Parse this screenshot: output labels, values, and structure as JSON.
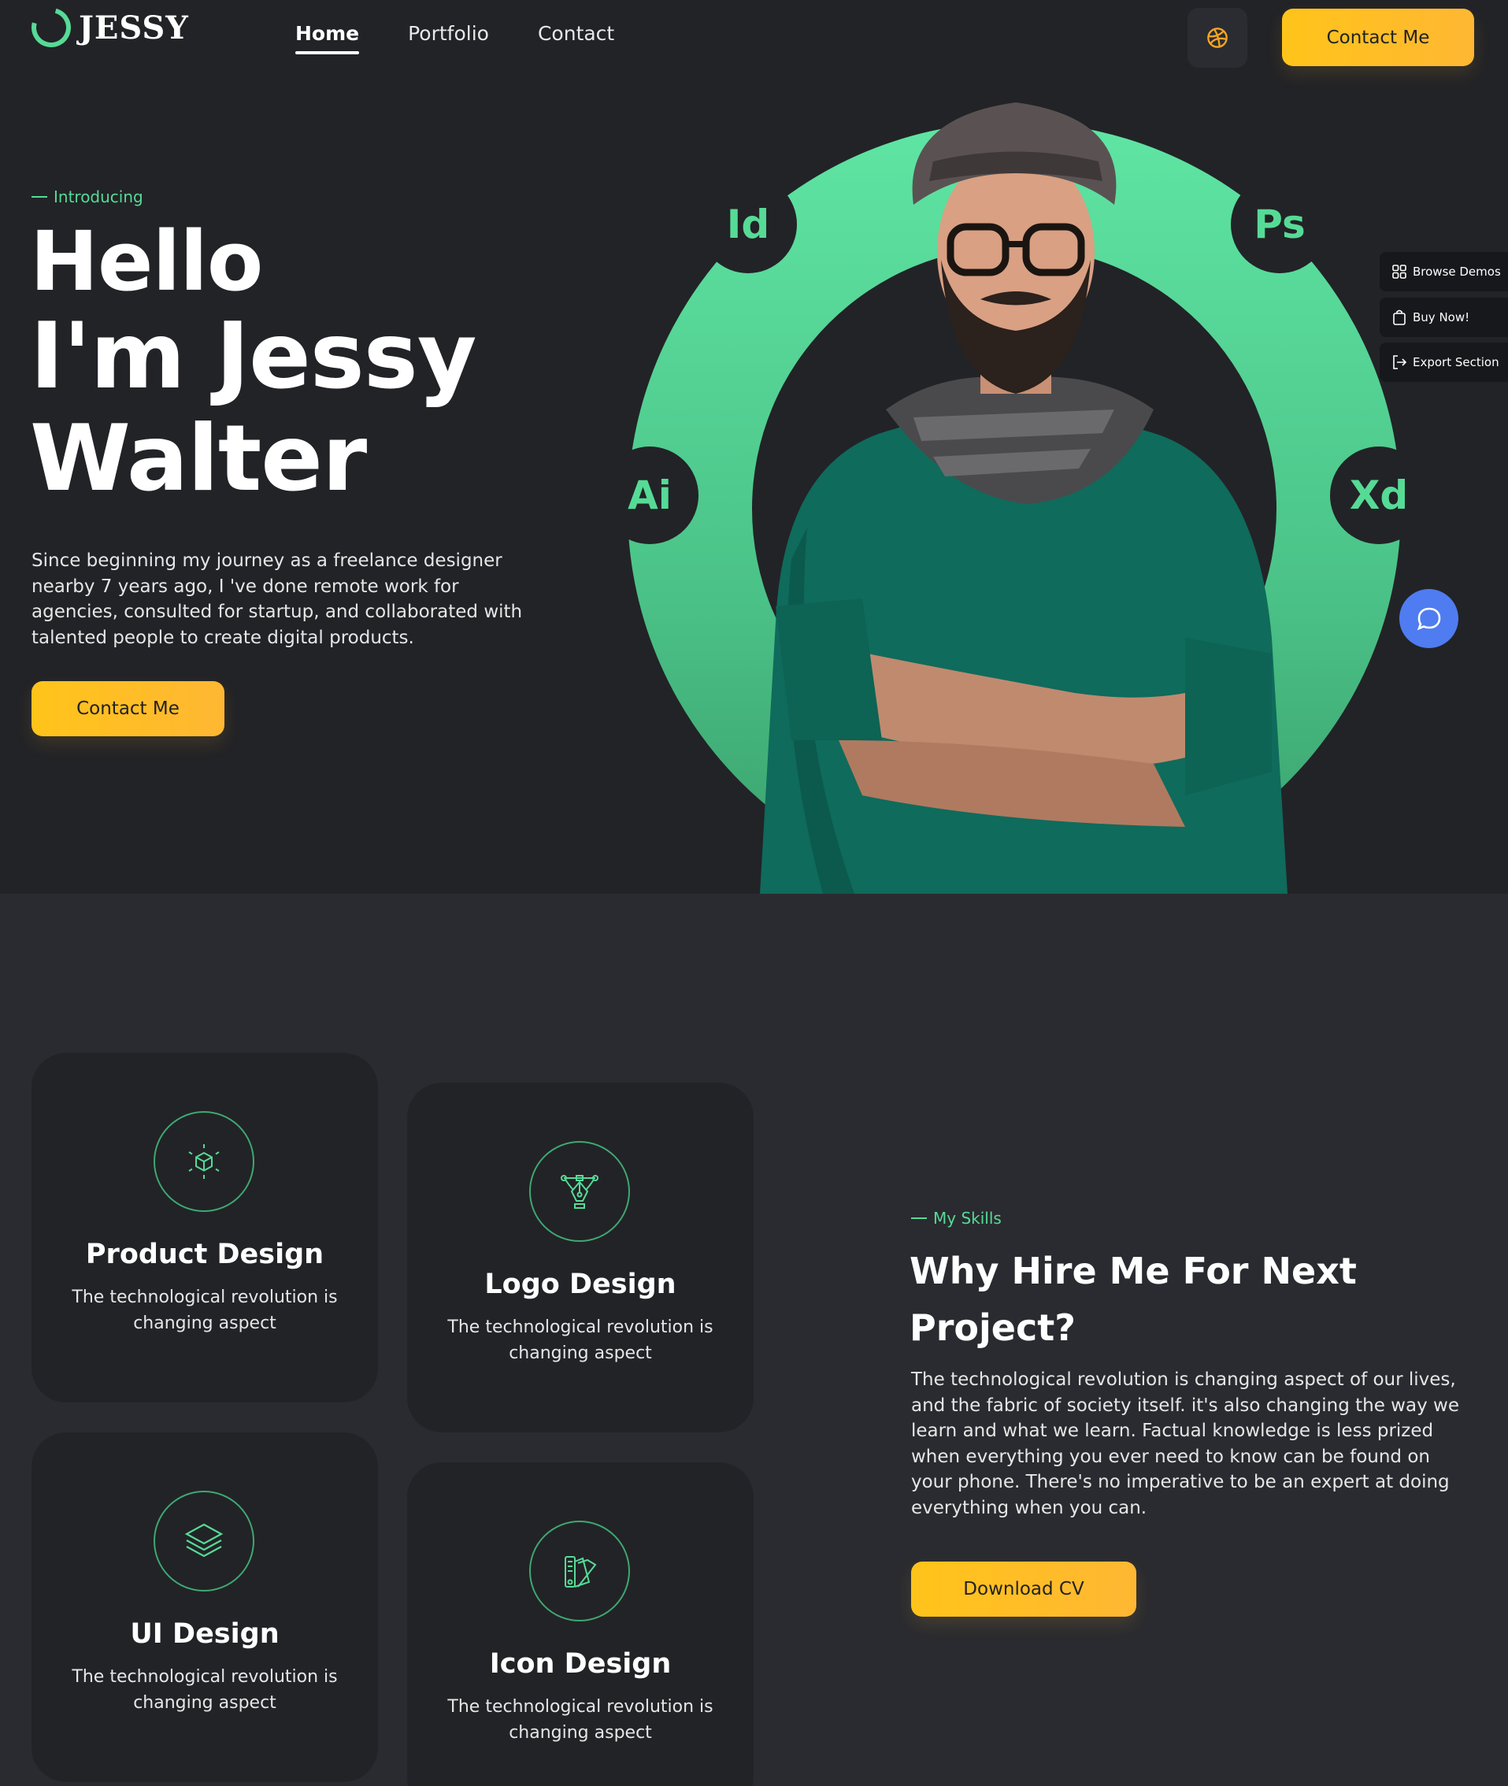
{
  "header": {
    "logo_text": "JESSY",
    "nav": [
      {
        "label": "Home",
        "active": true
      },
      {
        "label": "Portfolio",
        "active": false
      },
      {
        "label": "Contact",
        "active": false
      }
    ],
    "dribbble_icon": "dribbble-icon",
    "contact_label": "Contact Me"
  },
  "hero": {
    "tag": "Introducing",
    "title_line1": "Hello",
    "title_line2": "I'm Jessy",
    "title_line3": "Walter",
    "description": "Since beginning my journey as a freelance designer nearby 7 years ago, I 've done remote work for agencies, consulted for startup, and collaborated with talented people to create digital products.",
    "contact_label": "Contact Me",
    "badges": [
      "Id",
      "Ps",
      "Ai",
      "Xd"
    ]
  },
  "side_tools": [
    {
      "label": "Browse Demos",
      "icon": "grid-icon"
    },
    {
      "label": "Buy Now!",
      "icon": "bag-icon"
    },
    {
      "label": "Export Section",
      "icon": "export-icon"
    }
  ],
  "chat": {
    "icon": "chat-icon"
  },
  "services": [
    {
      "title": "Product Design",
      "desc": "The technological revolution is changing aspect",
      "icon": "cube-icon"
    },
    {
      "title": "Logo Design",
      "desc": "The technological revolution is changing aspect",
      "icon": "pen-tool-icon"
    },
    {
      "title": "UI Design",
      "desc": "The technological revolution is changing aspect",
      "icon": "layers-icon"
    },
    {
      "title": "Icon Design",
      "desc": "The technological revolution is changing aspect",
      "icon": "swatches-icon"
    }
  ],
  "skills": {
    "tag": "My Skills",
    "title": "Why Hire Me For Next Project?",
    "description": "The technological revolution is changing aspect of our lives, and the fabric of society itself. it's also changing the way we learn and what we learn. Factual knowledge is less prized when everything you ever need to know can be found on your phone. There's no imperative to be an expert at doing everything when you can.",
    "button_label": "Download CV"
  },
  "colors": {
    "accent": "#56db96",
    "button": "#ffc41a",
    "background": "#222327",
    "section_background": "#2a2b30",
    "chat": "#4f7cf0"
  }
}
